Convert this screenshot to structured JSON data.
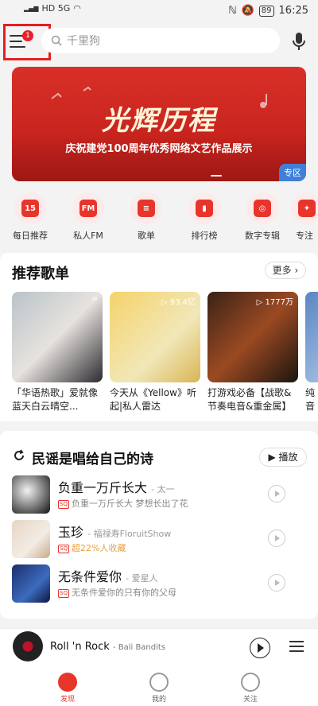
{
  "status_bar": {
    "left": "HD 5G",
    "battery": "89",
    "time": "16:25"
  },
  "top_bar": {
    "badge_count": "1",
    "search_placeholder": "千里狗"
  },
  "banner": {
    "title": "光辉历程",
    "subtitle": "庆祝建党100周年优秀网络文艺作品展示",
    "tag": "专区"
  },
  "quick_entries": [
    {
      "label": "每日推荐",
      "glyph": "15"
    },
    {
      "label": "私人FM",
      "glyph": "FM"
    },
    {
      "label": "歌单",
      "glyph": "≡"
    },
    {
      "label": "排行榜",
      "glyph": "▮"
    },
    {
      "label": "数字专辑",
      "glyph": "◎"
    },
    {
      "label": "专注",
      "glyph": "✦"
    }
  ],
  "recommended": {
    "title": "推荐歌单",
    "more": "更多",
    "playlists": [
      {
        "text": "「华语热歌」爱就像蓝天白云晴空...",
        "count": ""
      },
      {
        "text": "今天从《Yellow》听起|私人雷达",
        "count": "93.4亿"
      },
      {
        "text": "打游戏必备【战歌&节奏电音&重金属】",
        "count": "1777万"
      },
      {
        "text": "纯音乐 治愈系",
        "count": ""
      }
    ]
  },
  "folk": {
    "title": "民谣是唱给自己的诗",
    "play_label": "播放",
    "songs": [
      {
        "title": "负重一万斤长大",
        "artist": "- 太一",
        "sub": "负重一万斤长大 梦想长出了花",
        "hot": ""
      },
      {
        "title": "玉珍",
        "artist": "- 福禄寿FloruitShow",
        "sub": "",
        "hot": "超22%人收藏"
      },
      {
        "title": "无条件爱你",
        "artist": "- 爱星人",
        "sub": "无条件爱你的只有你的父母",
        "hot": ""
      }
    ]
  },
  "player": {
    "title": "Roll 'n Rock",
    "artist": "- Bali Bandits"
  },
  "tabs": [
    {
      "label": "发现"
    },
    {
      "label": "我的"
    },
    {
      "label": "关注"
    }
  ],
  "colors": {
    "accent": "#e8352c",
    "badge": "#e8202a",
    "banner_tag": "#3f7fd9"
  }
}
